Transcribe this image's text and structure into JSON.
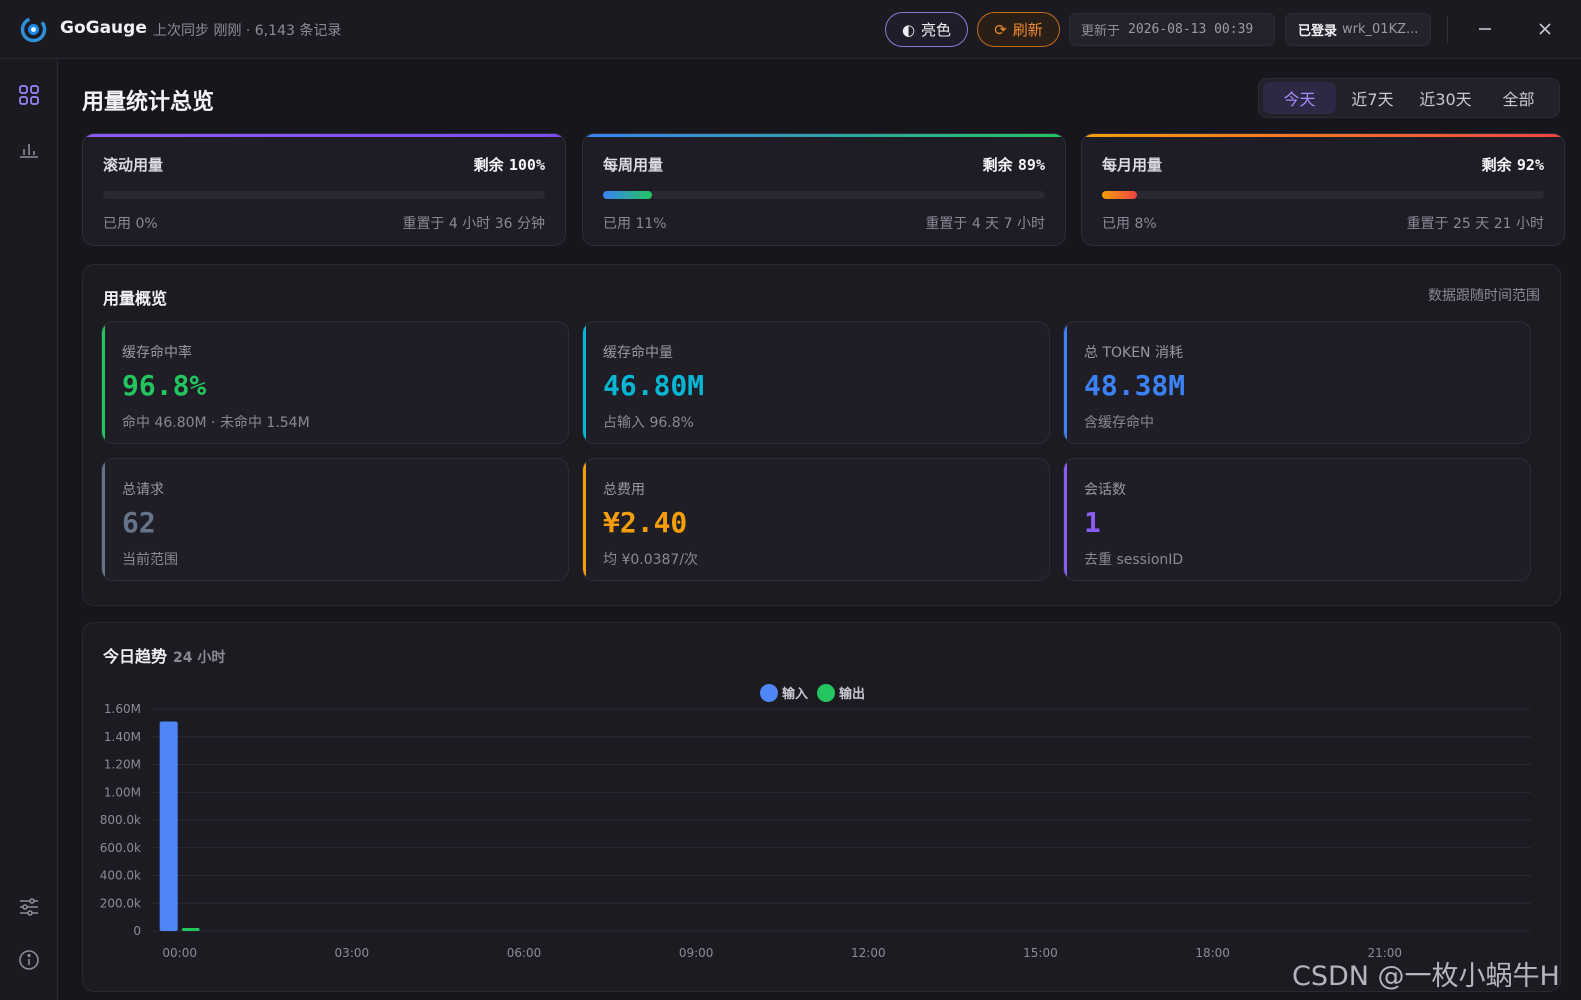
{
  "app": {
    "name": "GoGauge",
    "sync_info": "上次同步 刚刚 · 6,143 条记录",
    "theme_button": "亮色",
    "refresh_button": "刷新",
    "updated_label": "更新于",
    "updated_time": "2026-08-13 00:39",
    "login_label": "已登录",
    "login_user": "wrk_01KZ..."
  },
  "sidebar": {
    "items": [
      "dashboard-icon",
      "chart-icon",
      "sliders-icon",
      "info-icon"
    ]
  },
  "page": {
    "title": "用量统计总览",
    "range_tabs": [
      "今天",
      "近7天",
      "近30天",
      "全部"
    ],
    "active_tab": "今天"
  },
  "quotas": [
    {
      "label": "滚动用量",
      "remain_label": "剩余",
      "remain": "100%",
      "used": "已用 0%",
      "used_fraction": 0.0,
      "reset": "重置于 4 小时 36 分钟",
      "colors": [
        "#8b5cf6",
        "#7c4df0"
      ]
    },
    {
      "label": "每周用量",
      "remain_label": "剩余",
      "remain": "89%",
      "used": "已用 11%",
      "used_fraction": 0.11,
      "reset": "重置于 4 天 7 小时",
      "colors": [
        "#3b82f6",
        "#22c55e"
      ]
    },
    {
      "label": "每月用量",
      "remain_label": "剩余",
      "remain": "92%",
      "used": "已用 8%",
      "used_fraction": 0.08,
      "reset": "重置于 25 天 21 小时",
      "colors": [
        "#f59e0b",
        "#ef4444"
      ]
    }
  ],
  "overview": {
    "title": "用量概览",
    "note": "数据跟随时间范围",
    "stats": [
      {
        "label": "缓存命中率",
        "value": "96.8%",
        "sub": "命中 46.80M · 未命中 1.54M",
        "color": "#22c55e"
      },
      {
        "label": "缓存命中量",
        "value": "46.80M",
        "sub": "占输入 96.8%",
        "color": "#06b6d4"
      },
      {
        "label": "总 TOKEN 消耗",
        "value": "48.38M",
        "sub": "含缓存命中",
        "color": "#3b82f6"
      },
      {
        "label": "总请求",
        "value": "62",
        "sub": "当前范围",
        "color": "#64748b"
      },
      {
        "label": "总费用",
        "value": "¥2.40",
        "sub": "均 ¥0.0387/次",
        "color": "#f59e0b"
      },
      {
        "label": "会话数",
        "value": "1",
        "sub": "去重 sessionID",
        "color": "#8b5cf6"
      }
    ]
  },
  "trend": {
    "title": "今日趋势",
    "subtitle": "24 小时"
  },
  "chart_data": {
    "type": "bar",
    "title": "",
    "xlabel": "",
    "ylabel": "",
    "categories": [
      "00:00",
      "01:00",
      "02:00",
      "03:00",
      "04:00",
      "05:00",
      "06:00",
      "07:00",
      "08:00",
      "09:00",
      "10:00",
      "11:00",
      "12:00",
      "13:00",
      "14:00",
      "15:00",
      "16:00",
      "17:00",
      "18:00",
      "19:00",
      "20:00",
      "21:00",
      "22:00",
      "23:00"
    ],
    "x_tick_labels": [
      "00:00",
      "03:00",
      "06:00",
      "09:00",
      "12:00",
      "15:00",
      "18:00",
      "21:00"
    ],
    "y_tick_labels": [
      "0",
      "200.0k",
      "400.0k",
      "600.0k",
      "800.0k",
      "1.00M",
      "1.20M",
      "1.40M",
      "1.60M"
    ],
    "ylim": [
      0,
      1600000
    ],
    "grid": true,
    "legend_position": "top-center",
    "series": [
      {
        "name": "输入",
        "color": "#4f86f7",
        "values": [
          1510000,
          0,
          0,
          0,
          0,
          0,
          0,
          0,
          0,
          0,
          0,
          0,
          0,
          0,
          0,
          0,
          0,
          0,
          0,
          0,
          0,
          0,
          0,
          0
        ]
      },
      {
        "name": "输出",
        "color": "#22c55e",
        "values": [
          22000,
          0,
          0,
          0,
          0,
          0,
          0,
          0,
          0,
          0,
          0,
          0,
          0,
          0,
          0,
          0,
          0,
          0,
          0,
          0,
          0,
          0,
          0,
          0
        ]
      }
    ]
  },
  "watermark": "CSDN @一枚小蜗牛H"
}
